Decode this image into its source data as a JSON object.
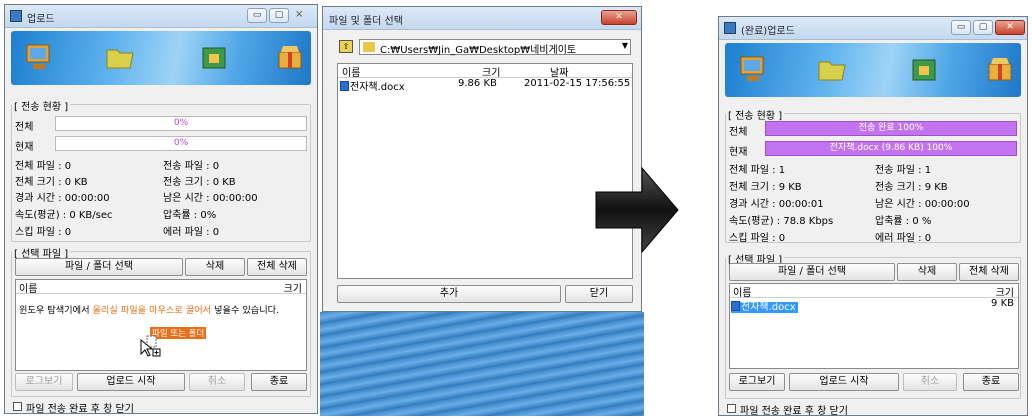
{
  "left_window": {
    "title": "업로드",
    "transfer_group": "[ 전송 현황 ]",
    "total_label": "전체",
    "total_percent": "0%",
    "current_label": "현재",
    "current_percent": "0%",
    "stats": {
      "total_files": "전체 파일 :  0",
      "sent_files": "전송 파일 :  0",
      "total_size": "전체 크기 :  0 KB",
      "sent_size": "전송 크기 :  0 KB",
      "elapsed": "경과 시간 :  00:00:00",
      "remaining": "남은 시간 :  00:00:00",
      "speed": "속도(평균) : 0 KB/sec",
      "ratio": "압축률 :     0%",
      "skip": "스킵 파일 :  0",
      "error": "에러 파일 :  0"
    },
    "select_group": "[ 선택 파일 ]",
    "select_button": "파일 / 폴더 선택",
    "delete_button": "삭제",
    "delete_all_button": "전체 삭제",
    "col_name": "이름",
    "col_size": "크기",
    "hint_pre": "윈도우 탐색기에서 ",
    "hint_mid": "올리실 파일을 마우스로 끌어서",
    "hint_post": " 넣을수 있습니다.",
    "drag_tag": "파일 또는 폴더",
    "log_button": "로그보기",
    "upload_button": "업로드 시작",
    "cancel_button": "취소",
    "exit_button": "종료",
    "close_after": "파일 전송 완료 후 창 닫기"
  },
  "picker": {
    "title": "파일 및 폴더 선택",
    "path": "C:₩Users₩Jin_Ga₩Desktop₩네비게이토",
    "col_name": "이름",
    "col_size": "크기",
    "col_date": "날짜",
    "file_name": "전자책.docx",
    "file_size": "9.86 KB",
    "file_date": "2011-02-15 17:56:55",
    "add_button": "추가",
    "close_button": "닫기"
  },
  "right_window": {
    "title": "(완료)업로드",
    "transfer_group": "[ 전송 현황 ]",
    "total_label": "전체",
    "total_text": "전송 완료 100%",
    "current_label": "현재",
    "current_text": "전자책.docx (9.86 KB) 100%",
    "total_progress": 1.0,
    "current_progress": 1.0,
    "stats": {
      "total_files": "전체 파일 :  1",
      "sent_files": "전송 파일 :  1",
      "total_size": "전체 크기 :  9 KB",
      "sent_size": "전송 크기 :  9 KB",
      "elapsed": "경과 시간 :  00:00:01",
      "remaining": "남은 시간 :  00:00:00",
      "speed": "속도(평균) :  78.8 Kbps",
      "ratio": "압축률 :      0 %",
      "skip": "스킵 파일 :  0",
      "error": "에러 파일 :  0"
    },
    "select_group": "[ 선택 파일 ]",
    "select_button": "파일 / 폴더 선택",
    "delete_button": "삭제",
    "delete_all_button": "전체 삭제",
    "col_name": "이름",
    "col_size": "크기",
    "file_name": "전자책.docx",
    "file_size": "9 KB",
    "log_button": "로그보기",
    "upload_button": "업로드 시작",
    "cancel_button": "취소",
    "exit_button": "종료",
    "close_after": "파일 전송 완료 후 창 닫기"
  },
  "colors": {
    "progress_fill": "#c274ee",
    "selection": "#3399ff",
    "hint_highlight": "#e8701a"
  }
}
